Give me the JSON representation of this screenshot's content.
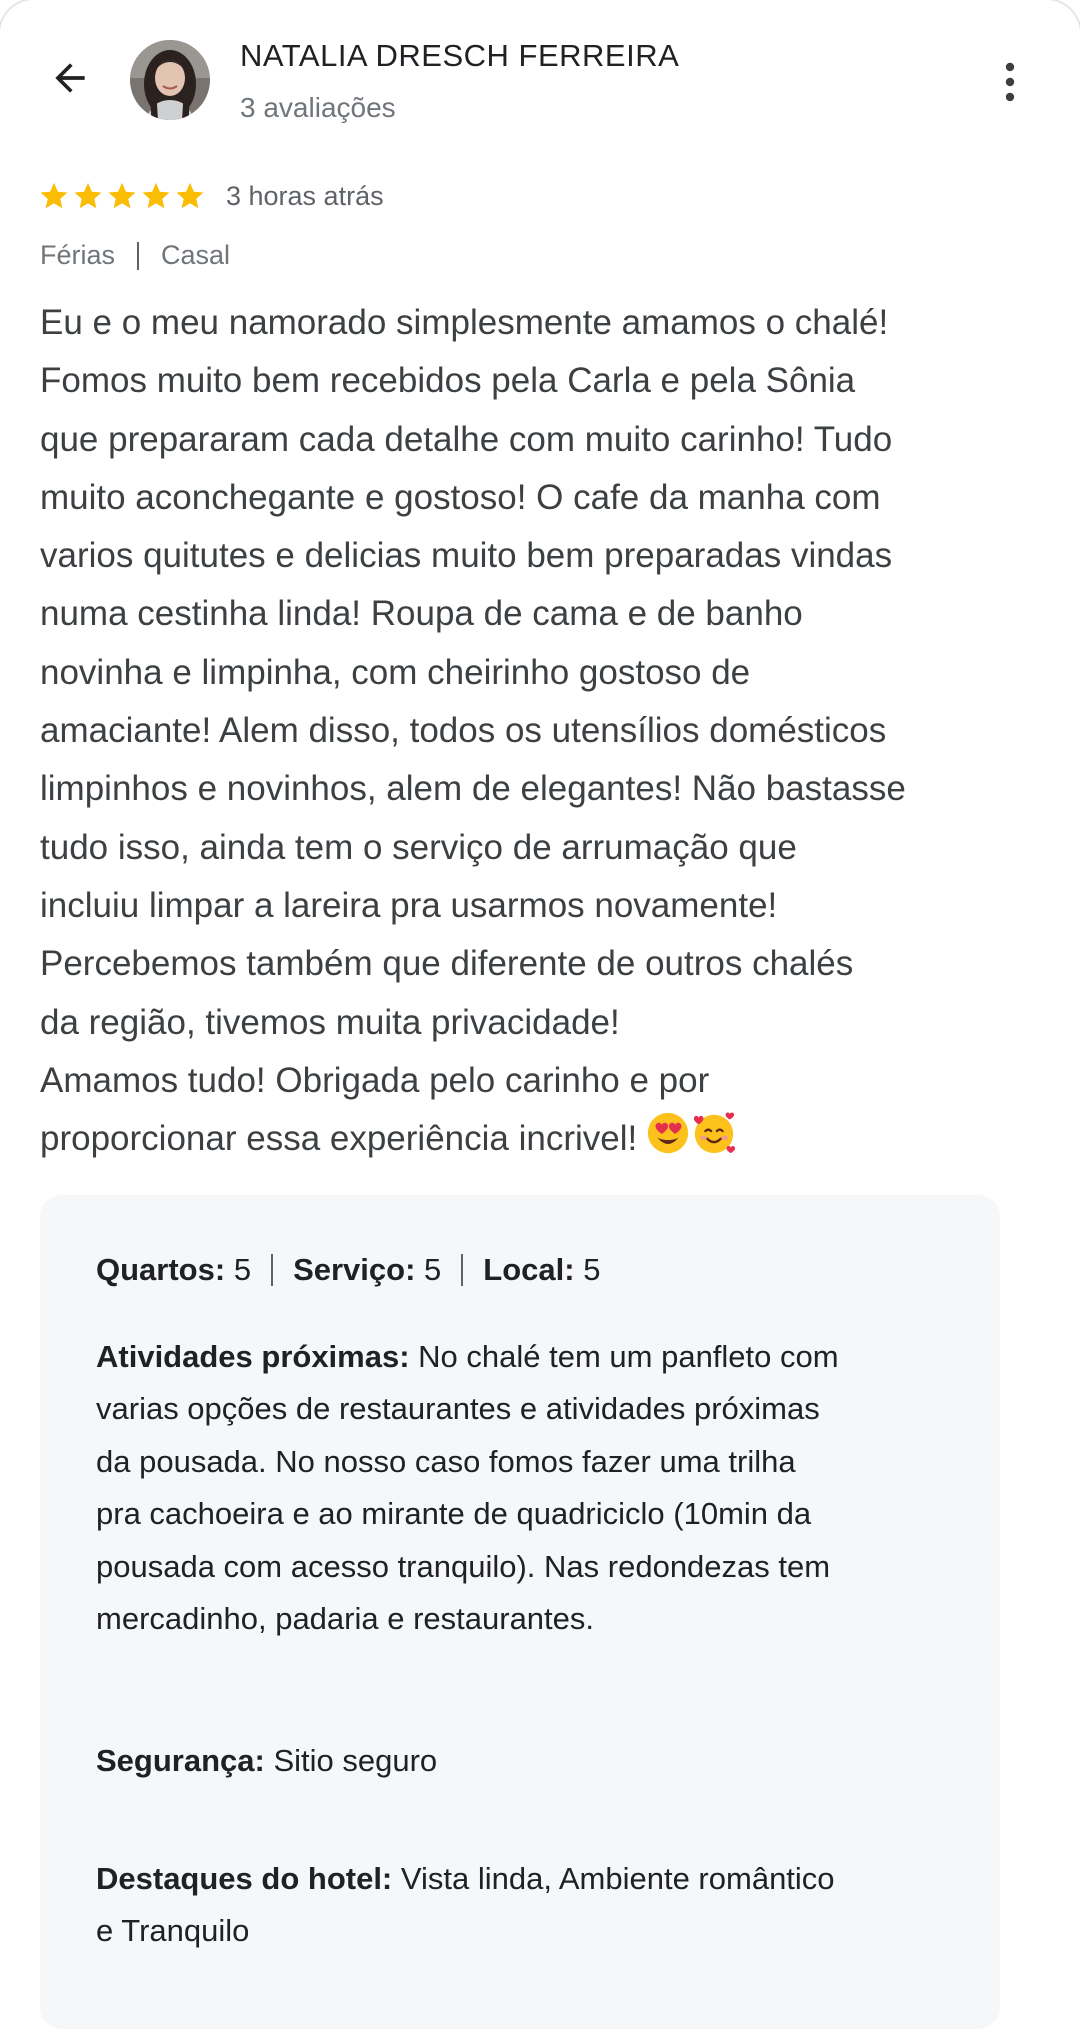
{
  "header": {
    "author_name": "NATALIA DRESCH FERREIRA",
    "review_count": "3 avaliações"
  },
  "icons": {
    "back": "arrow-back-icon",
    "more": "more-vertical-icon",
    "star": "star-icon"
  },
  "review": {
    "rating": 5,
    "time_ago": "3 horas atrás",
    "tags": [
      "Férias",
      "Casal"
    ],
    "text_lines": [
      "Eu e o meu namorado simplesmente amamos o chalé!",
      "Fomos muito bem recebidos pela Carla e pela Sônia",
      "que prepararam cada detalhe com muito carinho! Tudo",
      "muito aconchegante e gostoso! O cafe da manha com",
      "varios quitutes e delicias muito bem preparadas vindas",
      "numa cestinha linda! Roupa de cama e de banho",
      "novinha e limpinha, com cheirinho gostoso de",
      "amaciante! Alem disso, todos os utensílios domésticos",
      "limpinhos e novinhos, alem de elegantes! Não bastasse",
      "tudo isso, ainda tem o serviço de arrumação que",
      "incluiu limpar a lareira pra usarmos novamente!",
      "Percebemos também que diferente de outros chalés",
      "da região, tivemos muita privacidade!",
      "Amamos tudo! Obrigada pelo carinho e por",
      "proporcionar essa experiência incrivel!"
    ],
    "emojis": [
      "smiling-face-with-heart-eyes",
      "smiling-face-with-hearts"
    ]
  },
  "details": {
    "ratings": [
      {
        "label": "Quartos:",
        "value": "5"
      },
      {
        "label": "Serviço:",
        "value": "5"
      },
      {
        "label": "Local:",
        "value": "5"
      }
    ],
    "nearby": {
      "label": "Atividades próximas:",
      "lines": [
        " No chalé tem um panfleto com",
        "varias opções de restaurantes e atividades próximas",
        "da pousada. No nosso caso fomos fazer uma trilha",
        "pra cachoeira e ao mirante de quadriciclo (10min da",
        "pousada com acesso tranquilo). Nas redondezas tem",
        "mercadinho, padaria e restaurantes."
      ]
    },
    "safety": {
      "label": "Segurança:",
      "text": " Sitio seguro"
    },
    "highlights": {
      "label": "Destaques do hotel:",
      "lines": [
        " Vista linda, Ambiente romântico",
        "e Tranquilo"
      ]
    }
  },
  "colors": {
    "star": "#fbbc04",
    "primary_text": "#202124",
    "secondary_text": "#70757a",
    "body_text": "#3c4043",
    "details_background": "#f6f7f9"
  }
}
